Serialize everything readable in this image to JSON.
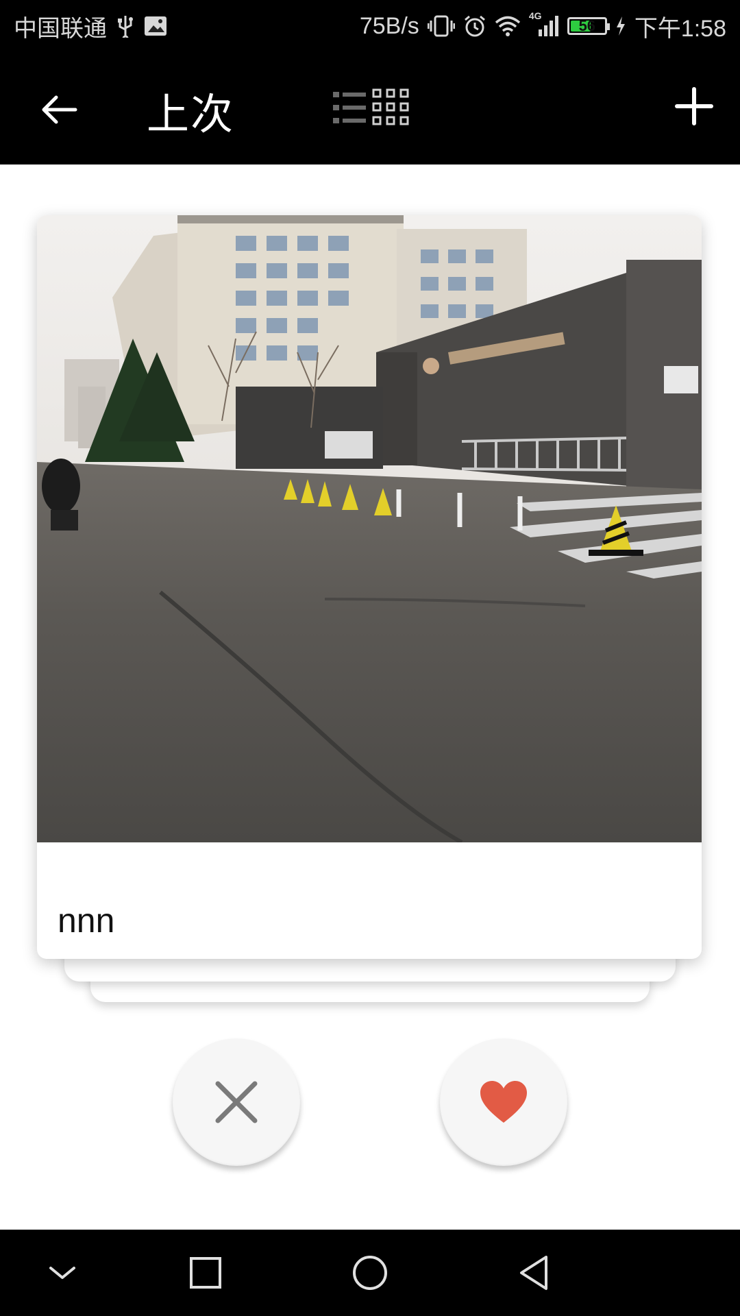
{
  "status_bar": {
    "carrier": "中国联通",
    "network_speed": "75B/s",
    "network_type": "4G",
    "battery_level": "56",
    "time": "下午1:58",
    "icons": [
      "usb-icon",
      "image-notification-icon",
      "vibrate-icon",
      "alarm-icon",
      "wifi-icon",
      "signal-icon",
      "battery-icon",
      "charging-icon"
    ]
  },
  "app_bar": {
    "title": "上次",
    "icons": [
      "back-arrow-icon",
      "list-view-icon",
      "grid-view-icon",
      "plus-icon"
    ]
  },
  "card": {
    "photo_description": "Street view of a campus gate with traffic cones",
    "caption": "nnn"
  },
  "actions": {
    "dislike_icon": "close-icon",
    "like_icon": "heart-icon",
    "like_color": "#e25b45",
    "dislike_color": "#7a7a7a"
  },
  "nav_bar": {
    "icons": [
      "chevron-down-icon",
      "recents-square-icon",
      "home-circle-icon",
      "back-triangle-icon"
    ]
  },
  "colors": {
    "bar_background": "#000000",
    "battery_fill": "#2ecc40"
  }
}
